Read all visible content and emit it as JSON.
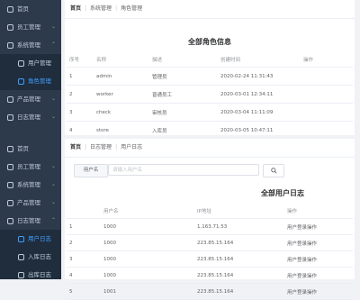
{
  "sidebar_top": {
    "items": [
      {
        "label": "首页",
        "icon": "home-icon"
      },
      {
        "label": "员工管理",
        "icon": "user-icon",
        "chevron": "⌄"
      },
      {
        "label": "系统管理",
        "icon": "gear-icon",
        "chevron": "⌃"
      },
      {
        "label": "用户管理",
        "icon": "list-icon",
        "sub": true
      },
      {
        "label": "角色管理",
        "icon": "role-icon",
        "sub": true,
        "active": true
      },
      {
        "label": "产品管理",
        "icon": "box-icon",
        "chevron": "⌄"
      },
      {
        "label": "日志管理",
        "icon": "log-icon",
        "chevron": "⌄"
      }
    ]
  },
  "sidebar_bottom": {
    "items": [
      {
        "label": "首页",
        "icon": "home-icon"
      },
      {
        "label": "员工管理",
        "icon": "user-icon",
        "chevron": "⌄"
      },
      {
        "label": "系统管理",
        "icon": "gear-icon",
        "chevron": "⌄"
      },
      {
        "label": "产品管理",
        "icon": "box-icon",
        "chevron": "⌄"
      },
      {
        "label": "日志管理",
        "icon": "log-icon",
        "chevron": "⌃"
      },
      {
        "label": "用户日志",
        "icon": "doc-icon",
        "sub": true,
        "active": true
      },
      {
        "label": "入库日志",
        "icon": "in-icon",
        "sub": true
      },
      {
        "label": "出库日志",
        "icon": "out-icon",
        "sub": true
      }
    ]
  },
  "roles_panel": {
    "breadcrumb": [
      "首页",
      "系统管理",
      "角色管理"
    ],
    "title": "全部角色信息",
    "columns": [
      "序号",
      "名称",
      "描述",
      "创建时间",
      "操作"
    ],
    "rows": [
      [
        "1",
        "admin",
        "管理员",
        "2020-02-24 11:31:43",
        ""
      ],
      [
        "2",
        "worker",
        "普通员工",
        "2020-03-01 12:34:11",
        ""
      ],
      [
        "3",
        "check",
        "审核员",
        "2020-03-04 11:11:09",
        ""
      ],
      [
        "4",
        "store",
        "入库员",
        "2020-03-05 10:47:11",
        ""
      ]
    ]
  },
  "logs_panel": {
    "breadcrumb": [
      "首页",
      "日志管理",
      "用户日志"
    ],
    "search_label": "用户名",
    "search_placeholder": "请输入用户名",
    "search_button_icon": "search-icon",
    "title": "全部用户日志",
    "columns": [
      "",
      "用户名",
      "IP地址",
      "操作"
    ],
    "rows": [
      [
        "1",
        "1000",
        "1.163.71.53",
        "用户登录操作"
      ],
      [
        "2",
        "1000",
        "223.85.15.164",
        "用户登录操作"
      ],
      [
        "3",
        "1000",
        "223.85.15.164",
        "用户登录操作"
      ],
      [
        "4",
        "1000",
        "223.85.15.164",
        "用户登录操作"
      ],
      [
        "5",
        "1001",
        "223.85.15.164",
        "用户登录操作"
      ]
    ]
  }
}
